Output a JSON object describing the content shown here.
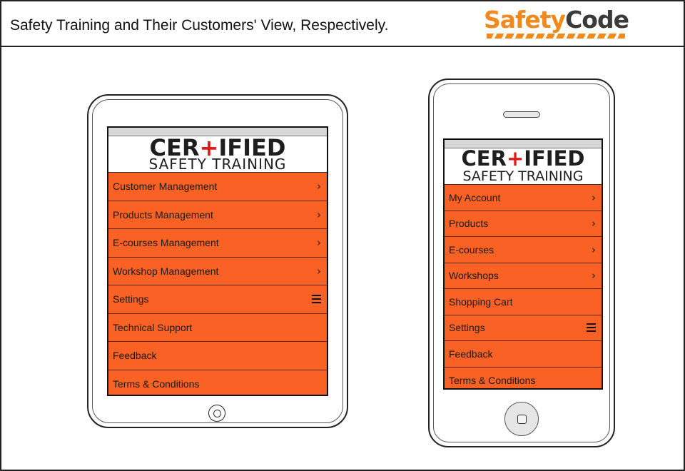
{
  "header": {
    "title": "Safety Training and Their Customers' View, Respectively.",
    "logo": {
      "part1": "Safety",
      "part2": "Code",
      "color_primary": "#f08a1c",
      "color_secondary": "#3a3a3a"
    }
  },
  "brand": {
    "line1_a": "CER",
    "line1_cross": "+",
    "line1_b": "IFIED",
    "line2": "SAFETY TRAINING",
    "cross_color": "#e11b1b"
  },
  "menu_color": "#fa6124",
  "tablet": {
    "menu": [
      {
        "label": "Customer Management",
        "icon": "chevron-right-icon"
      },
      {
        "label": "Products Management",
        "icon": "chevron-right-icon"
      },
      {
        "label": "E-courses Management",
        "icon": "chevron-right-icon"
      },
      {
        "label": "Workshop Management",
        "icon": "chevron-right-icon"
      },
      {
        "label": "Settings",
        "icon": "hamburger-menu-icon"
      },
      {
        "label": "Technical Support",
        "icon": ""
      },
      {
        "label": "Feedback",
        "icon": ""
      },
      {
        "label": "Terms & Conditions",
        "icon": ""
      }
    ]
  },
  "phone": {
    "menu": [
      {
        "label": "My Account",
        "icon": "chevron-right-icon"
      },
      {
        "label": "Products",
        "icon": "chevron-right-icon"
      },
      {
        "label": "E-courses",
        "icon": "chevron-right-icon"
      },
      {
        "label": "Workshops",
        "icon": "chevron-right-icon"
      },
      {
        "label": "Shopping Cart",
        "icon": ""
      },
      {
        "label": "Settings",
        "icon": "hamburger-menu-icon"
      },
      {
        "label": "Feedback",
        "icon": ""
      },
      {
        "label": "Terms & Conditions",
        "icon": ""
      }
    ]
  }
}
